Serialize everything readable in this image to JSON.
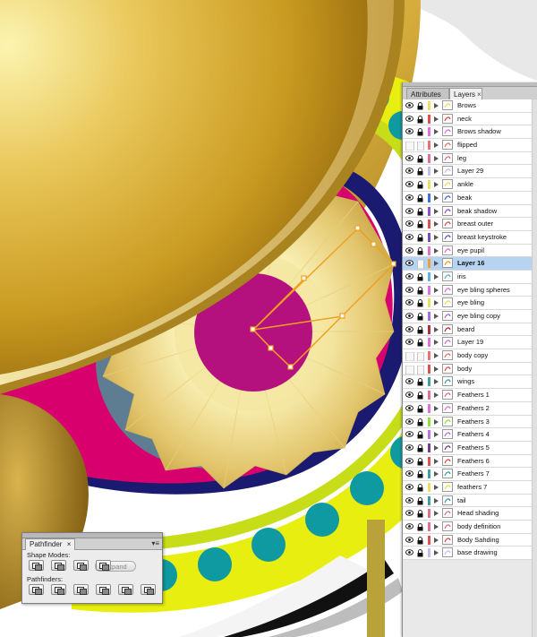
{
  "layers_panel": {
    "tabs": [
      {
        "label": "Attributes",
        "active": false
      },
      {
        "label": "Layers",
        "active": true
      }
    ],
    "close_glyph": "×",
    "menu_glyph": "▾≡",
    "layers": [
      {
        "name": "Brows",
        "color": "#f0e060",
        "visible": true,
        "locked": true,
        "selected": false
      },
      {
        "name": "neck",
        "color": "#e05050",
        "visible": true,
        "locked": true,
        "selected": false
      },
      {
        "name": "Brows shadow",
        "color": "#e070e0",
        "visible": true,
        "locked": true,
        "selected": false
      },
      {
        "name": "flipped",
        "color": "#f07070",
        "visible": false,
        "locked": false,
        "selected": false
      },
      {
        "name": "leg",
        "color": "#e07090",
        "visible": true,
        "locked": true,
        "selected": false
      },
      {
        "name": "Layer 29",
        "color": "#c0c0f0",
        "visible": true,
        "locked": true,
        "selected": false
      },
      {
        "name": "ankle",
        "color": "#e8e060",
        "visible": true,
        "locked": true,
        "selected": false
      },
      {
        "name": "beak",
        "color": "#4070e0",
        "visible": true,
        "locked": true,
        "selected": false
      },
      {
        "name": "beak shadow",
        "color": "#9050d0",
        "visible": true,
        "locked": true,
        "selected": false
      },
      {
        "name": "breast outer",
        "color": "#e05050",
        "visible": true,
        "locked": true,
        "selected": false
      },
      {
        "name": "breast keystroke",
        "color": "#7050c0",
        "visible": true,
        "locked": true,
        "selected": false
      },
      {
        "name": "eye pupil",
        "color": "#e070d0",
        "visible": true,
        "locked": true,
        "selected": false
      },
      {
        "name": "Layer 16",
        "color": "#f0a030",
        "visible": true,
        "locked": false,
        "selected": true
      },
      {
        "name": "iris",
        "color": "#60b0e0",
        "visible": true,
        "locked": true,
        "selected": false
      },
      {
        "name": "eye bling spheres",
        "color": "#e070e0",
        "visible": true,
        "locked": true,
        "selected": false
      },
      {
        "name": "eye bling",
        "color": "#e8e060",
        "visible": true,
        "locked": true,
        "selected": false
      },
      {
        "name": "eye bling copy",
        "color": "#a070e0",
        "visible": true,
        "locked": true,
        "selected": false
      },
      {
        "name": "beard",
        "color": "#b03040",
        "visible": true,
        "locked": true,
        "selected": false
      },
      {
        "name": "Layer 19",
        "color": "#e070e0",
        "visible": true,
        "locked": true,
        "selected": false
      },
      {
        "name": "body copy",
        "color": "#f07070",
        "visible": false,
        "locked": false,
        "selected": false
      },
      {
        "name": "body",
        "color": "#e05050",
        "visible": false,
        "locked": false,
        "selected": false
      },
      {
        "name": "wings",
        "color": "#40a0a0",
        "visible": true,
        "locked": true,
        "selected": false
      },
      {
        "name": "Feathers 1",
        "color": "#e07090",
        "visible": true,
        "locked": true,
        "selected": false
      },
      {
        "name": "Feathers 2",
        "color": "#e070e0",
        "visible": true,
        "locked": true,
        "selected": false
      },
      {
        "name": "Feathers 3",
        "color": "#90e040",
        "visible": true,
        "locked": true,
        "selected": false
      },
      {
        "name": "Feathers 4",
        "color": "#c070e0",
        "visible": true,
        "locked": true,
        "selected": false
      },
      {
        "name": "Feathers 5",
        "color": "#704090",
        "visible": true,
        "locked": true,
        "selected": false
      },
      {
        "name": "Feathers 6",
        "color": "#e05050",
        "visible": true,
        "locked": true,
        "selected": false
      },
      {
        "name": "Feathers 7",
        "color": "#40a0a0",
        "visible": true,
        "locked": true,
        "selected": false
      },
      {
        "name": "feathers 7",
        "color": "#e8e060",
        "visible": true,
        "locked": true,
        "selected": false
      },
      {
        "name": "tail",
        "color": "#40a0a0",
        "visible": true,
        "locked": true,
        "selected": false
      },
      {
        "name": "Head shading",
        "color": "#e07090",
        "visible": true,
        "locked": true,
        "selected": false
      },
      {
        "name": "body definition",
        "color": "#e07090",
        "visible": true,
        "locked": true,
        "selected": false
      },
      {
        "name": "Body Sahding",
        "color": "#e05050",
        "visible": true,
        "locked": true,
        "selected": false
      },
      {
        "name": "base drawing",
        "color": "#c0c0f0",
        "visible": true,
        "locked": true,
        "selected": false
      }
    ]
  },
  "pathfinder": {
    "tab_label": "Pathfinder",
    "close_glyph": "×",
    "menu_glyph": "▾≡",
    "shape_modes_label": "Shape Modes:",
    "pathfinders_label": "Pathfinders:",
    "expand_label": "Expand",
    "shape_mode_icons": [
      "unite-icon",
      "minus-front-icon",
      "intersect-icon",
      "exclude-icon"
    ],
    "pathfinder_icons": [
      "divide-icon",
      "trim-icon",
      "merge-icon",
      "crop-icon",
      "outline-icon",
      "minus-back-icon"
    ]
  },
  "artwork": {
    "colors": {
      "gold": "#d4a629",
      "gold_light": "#f6e9a0",
      "magenta": "#d8006c",
      "pupil": "#b5117e",
      "teal": "#0e9aa0",
      "yellow": "#e8ee10",
      "navy": "#1a1a70",
      "slate": "#5f7d92",
      "selection": "#f0a020"
    }
  }
}
